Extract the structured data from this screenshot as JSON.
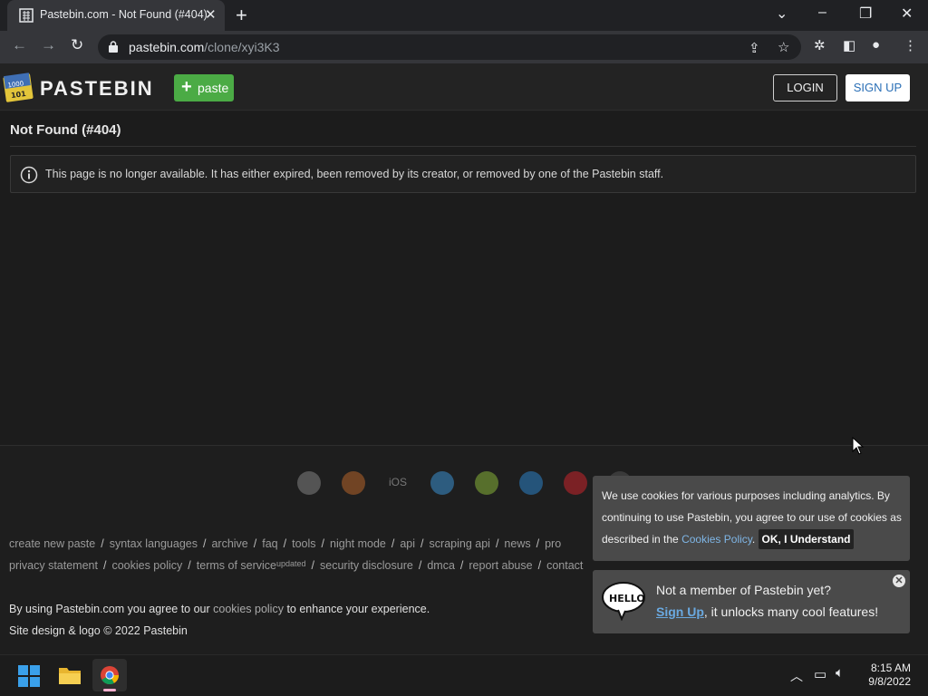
{
  "browser": {
    "tab_title": "Pastebin.com - Not Found (#404)",
    "url_host": "pastebin.com",
    "url_path": "/clone/xyi3K3"
  },
  "site": {
    "brand": "PASTEBIN",
    "paste_button": "paste",
    "login_button": "LOGIN",
    "signup_button": "SIGN UP"
  },
  "main": {
    "title": "Not Found (#404)",
    "notice": "This page is no longer available. It has either expired, been removed by its creator, or removed by one of the Pastebin staff."
  },
  "app_icons": [
    "chrome-icon",
    "firefox-icon",
    "ios-icon",
    "windows-icon",
    "android-icon",
    "x-icon",
    "opera-icon",
    "other-icon"
  ],
  "ios_label": "iOS",
  "footer": {
    "links_row1": [
      "create new paste",
      "syntax languages",
      "archive",
      "faq",
      "tools",
      "night mode",
      "api",
      "scraping api",
      "news",
      "pro"
    ],
    "links_row2": [
      "privacy statement",
      "cookies policy",
      "terms of service",
      "security disclosure",
      "dmca",
      "report abuse",
      "contact"
    ],
    "terms_badge": "updated",
    "agree_prefix": "By using Pastebin.com you agree to our",
    "agree_link": "cookies policy",
    "agree_suffix": "to enhance your experience.",
    "copyright": "Site design & logo © 2022 Pastebin"
  },
  "cookie_banner": {
    "text_1": "We use cookies for various purposes including analytics. By continuing to use Pastebin, you agree to our use of cookies as described in the",
    "link": "Cookies Policy",
    "text_2": ".",
    "ok_button": "OK, I Understand"
  },
  "promo": {
    "question": "Not a member of Pastebin yet?",
    "signup_link": "Sign Up",
    "cta_suffix": ", it unlocks many cool features!",
    "close_glyph": "✕"
  },
  "taskbar": {
    "time": "8:15 AM",
    "date": "9/8/2022"
  }
}
